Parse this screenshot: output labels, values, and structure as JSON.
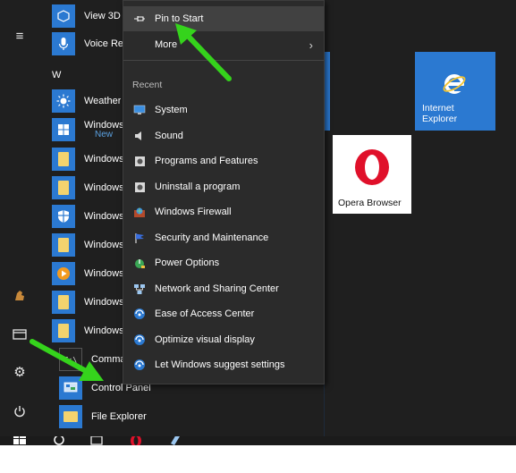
{
  "rail": {
    "items": [
      {
        "name": "hamburger-menu-icon",
        "glyph": "≡"
      },
      {
        "name": "user-avatar-icon",
        "glyph": "♞"
      },
      {
        "name": "file-explorer-icon",
        "glyph": "▭"
      },
      {
        "name": "settings-gear-icon",
        "glyph": "⚙"
      },
      {
        "name": "power-icon",
        "glyph": "⏻"
      }
    ]
  },
  "applist": {
    "section_letter": "W",
    "items": [
      {
        "label": "View 3D"
      },
      {
        "label": "Voice Re"
      },
      {
        "label": "Weather"
      },
      {
        "label": "Windows",
        "sub": "New"
      },
      {
        "label": "Windows"
      },
      {
        "label": "Windows"
      },
      {
        "label": "Windows"
      },
      {
        "label": "Windows"
      },
      {
        "label": "Windows"
      },
      {
        "label": "Windows"
      },
      {
        "label": "Windows"
      },
      {
        "label": "Comma"
      },
      {
        "label": "Control Panel"
      },
      {
        "label": "File Explorer"
      }
    ]
  },
  "context_menu": {
    "pin": "Pin to Start",
    "more": "More",
    "recent_heading": "Recent",
    "recent": [
      "System",
      "Sound",
      "Programs and Features",
      "Uninstall a program",
      "Windows Firewall",
      "Security and Maintenance",
      "Power Options",
      "Network and Sharing Center",
      "Ease of Access Center",
      "Optimize visual display",
      "Let Windows suggest settings"
    ]
  },
  "tiles": {
    "ie_line1": "Internet",
    "ie_line2": "Explorer",
    "opera": "Opera Browser"
  },
  "colors": {
    "accent": "#2b79d1",
    "annotation_arrow": "#35d31c",
    "opera_red": "#e0102a"
  }
}
